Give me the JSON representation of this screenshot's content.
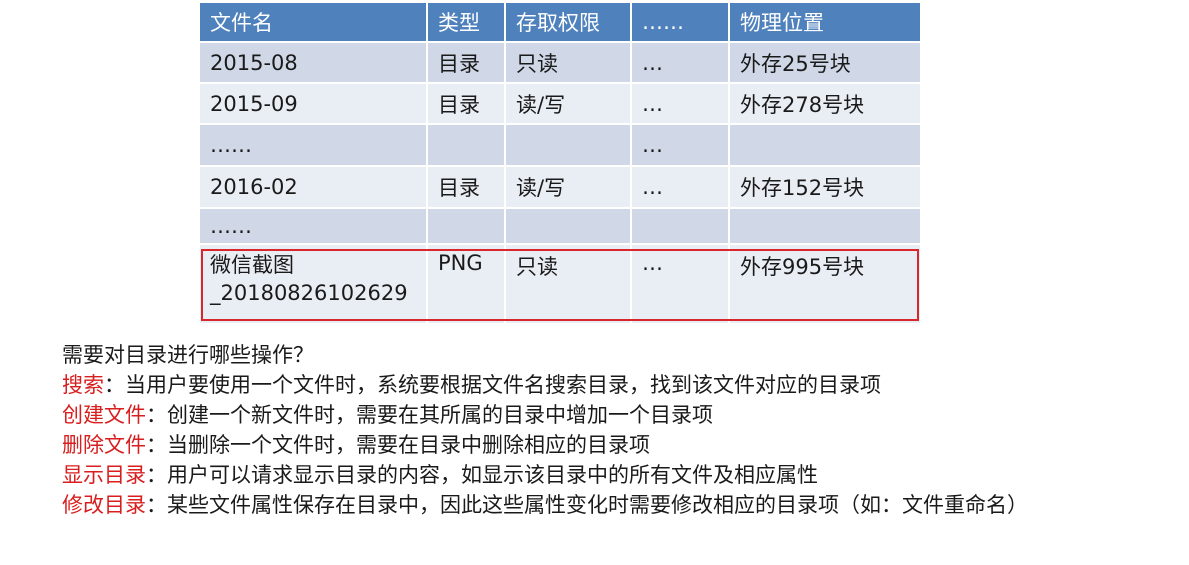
{
  "table": {
    "headers": [
      "文件名",
      "类型",
      "存取权限",
      "……",
      "物理位置"
    ],
    "rows": [
      [
        "2015-08",
        "目录",
        "只读",
        "…",
        "外存25号块"
      ],
      [
        "2015-09",
        "目录",
        "读/写",
        "…",
        "外存278号块"
      ],
      [
        "……",
        "",
        "",
        "…",
        ""
      ],
      [
        "2016-02",
        "目录",
        "读/写",
        "…",
        "外存152号块"
      ],
      [
        "……",
        "",
        "",
        "",
        ""
      ]
    ],
    "highlighted_row": {
      "name_line1": "微信截图",
      "name_line2": "_20180826102629",
      "type": "PNG",
      "access": "只读",
      "etc": "…",
      "location": "外存995号块"
    },
    "highlight_color": "#d9262b",
    "header_color": "#4f81bd"
  },
  "notes": {
    "question": "需要对目录进行哪些操作？",
    "items": [
      {
        "keyword": "搜索",
        "text": "：当用户要使用一个文件时，系统要根据文件名搜索目录，找到该文件对应的目录项"
      },
      {
        "keyword": "创建文件",
        "text": "：创建一个新文件时，需要在其所属的目录中增加一个目录项"
      },
      {
        "keyword": "删除文件",
        "text": "：当删除一个文件时，需要在目录中删除相应的目录项"
      },
      {
        "keyword": "显示目录",
        "text": "：用户可以请求显示目录的内容，如显示该目录中的所有文件及相应属性"
      },
      {
        "keyword": "修改目录",
        "text": "：某些文件属性保存在目录中，因此这些属性变化时需要修改相应的目录项（如：文件重命名）"
      }
    ],
    "keyword_color": "#d81e1e"
  }
}
